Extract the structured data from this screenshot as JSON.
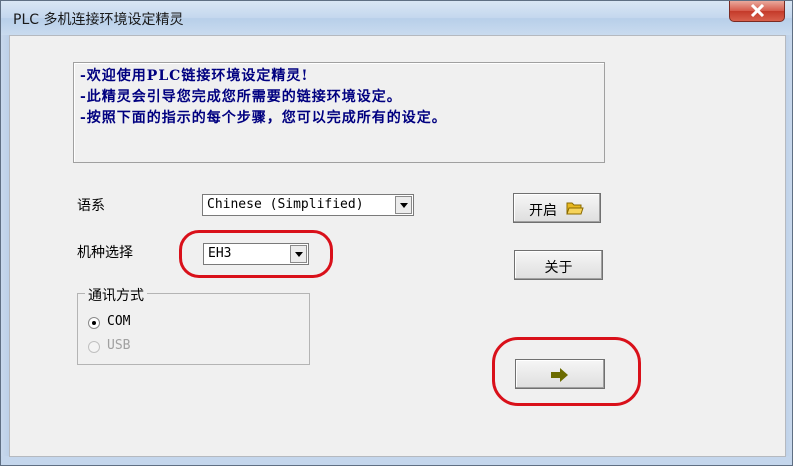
{
  "window": {
    "title": "PLC 多机连接环境设定精灵"
  },
  "intro": {
    "lines": [
      "-欢迎使用PLC链接环境设定精灵!",
      "-此精灵会引导您完成您所需要的链接环境设定。",
      "-按照下面的指示的每个步骤，您可以完成所有的设定。"
    ]
  },
  "language": {
    "label": "语系",
    "selected": "Chinese (Simplified)"
  },
  "model": {
    "label": "机种选择",
    "selected": "EH3"
  },
  "comm": {
    "group_label": "通讯方式",
    "com_label": "COM",
    "usb_label": "USB",
    "selected": "COM"
  },
  "buttons": {
    "open_label": "开启",
    "about_label": "关于",
    "next_icon": "right-arrow-icon",
    "open_icon": "folder-icon"
  },
  "colors": {
    "intro_text": "#000080",
    "annotation_red": "#d9101a",
    "arrow": "#6b6b00"
  }
}
